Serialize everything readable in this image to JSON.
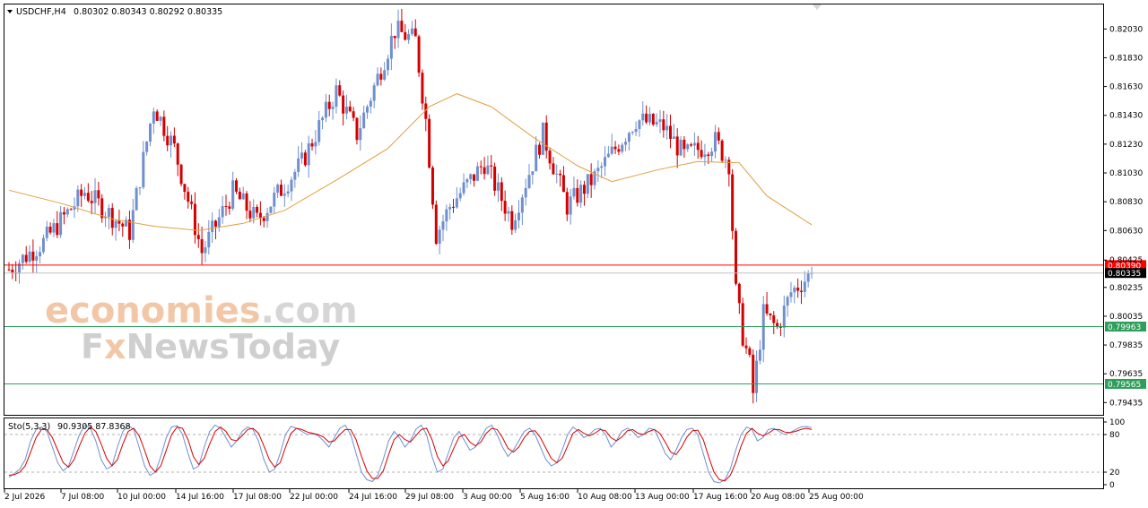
{
  "header": {
    "symbol": "USDCHF,H4",
    "ohlc": "0.80302 0.80343 0.80292 0.80335"
  },
  "watermark": {
    "line1_part1": "economies",
    "line1_part2": ".com",
    "line2_part1": "F",
    "line2_part2": "x",
    "line2_part3": "NewsToday"
  },
  "colors": {
    "bull": "#6f8fce",
    "bear": "#d40000",
    "ma": "#e0a040",
    "resistance": "#ff0000",
    "current": "#000000",
    "support": "#2e9e5b",
    "stoch_main": "#6f8fce",
    "stoch_signal": "#d40000",
    "watermark_orange": "#f2c7a7",
    "watermark_gray": "#cfcfcf"
  },
  "chart_data": [
    {
      "type": "candlestick",
      "ylim": [
        0.7935,
        0.822
      ],
      "y_ticks": [
        "0.82030",
        "0.81830",
        "0.81630",
        "0.81430",
        "0.81230",
        "0.81030",
        "0.80830",
        "0.80630",
        "0.80425",
        "0.80235",
        "0.80035",
        "0.79835",
        "0.79635",
        "0.79435"
      ],
      "x_ticks": [
        "2 Jul 2026",
        "7 Jul 08:00",
        "10 Jul 00:00",
        "14 Jul 16:00",
        "17 Jul 08:00",
        "22 Jul 00:00",
        "24 Jul 16:00",
        "29 Jul 08:00",
        "3 Aug 00:00",
        "5 Aug 16:00",
        "10 Aug 08:00",
        "13 Aug 00:00",
        "17 Aug 16:00",
        "20 Aug 08:00",
        "25 Aug 00:00"
      ],
      "moving_average": [
        [
          0,
          0.8091
        ],
        [
          15,
          0.8082
        ],
        [
          30,
          0.8071
        ],
        [
          42,
          0.8066
        ],
        [
          55,
          0.8063
        ],
        [
          68,
          0.8068
        ],
        [
          80,
          0.8077
        ],
        [
          95,
          0.8098
        ],
        [
          110,
          0.812
        ],
        [
          122,
          0.8149
        ],
        [
          130,
          0.8158
        ],
        [
          140,
          0.8149
        ],
        [
          152,
          0.8128
        ],
        [
          165,
          0.8108
        ],
        [
          175,
          0.8097
        ],
        [
          188,
          0.8105
        ],
        [
          200,
          0.8111
        ],
        [
          212,
          0.811
        ],
        [
          220,
          0.8087
        ],
        [
          233,
          0.8067
        ]
      ],
      "levels": [
        {
          "label": "0.80390",
          "value": 0.8039,
          "kind": "resistance"
        },
        {
          "label": "0.80335",
          "value": 0.80335,
          "kind": "current"
        },
        {
          "label": "0.79963",
          "value": 0.79963,
          "kind": "support"
        },
        {
          "label": "0.79565",
          "value": 0.79565,
          "kind": "support"
        }
      ],
      "anchors": [
        [
          0,
          0.8036
        ],
        [
          10,
          0.8055
        ],
        [
          22,
          0.809
        ],
        [
          35,
          0.8062
        ],
        [
          42,
          0.815
        ],
        [
          48,
          0.812
        ],
        [
          56,
          0.8048
        ],
        [
          65,
          0.809
        ],
        [
          72,
          0.807
        ],
        [
          85,
          0.811
        ],
        [
          95,
          0.816
        ],
        [
          101,
          0.813
        ],
        [
          112,
          0.8202
        ],
        [
          118,
          0.8195
        ],
        [
          121,
          0.814
        ],
        [
          124,
          0.806
        ],
        [
          128,
          0.808
        ],
        [
          138,
          0.811
        ],
        [
          146,
          0.807
        ],
        [
          155,
          0.813
        ],
        [
          162,
          0.808
        ],
        [
          170,
          0.81
        ],
        [
          182,
          0.814
        ],
        [
          190,
          0.8135
        ],
        [
          196,
          0.8115
        ],
        [
          205,
          0.8125
        ],
        [
          209,
          0.811
        ],
        [
          211,
          0.802
        ],
        [
          213,
          0.799
        ],
        [
          215,
          0.797
        ],
        [
          216,
          0.795
        ],
        [
          219,
          0.8005
        ],
        [
          223,
          0.7995
        ],
        [
          227,
          0.802
        ],
        [
          233,
          0.80335
        ]
      ],
      "x_count": 234
    },
    {
      "type": "line",
      "indicator": "Sto(5,3,3)",
      "values_label": "90.9305 87.8368",
      "ylim": [
        0,
        100
      ],
      "y_ticks": [
        "100",
        "80",
        "20",
        "0"
      ],
      "levels": [
        80,
        20
      ],
      "series": [
        {
          "name": "main",
          "values": [
            12,
            18,
            25,
            40,
            70,
            88,
            92,
            85,
            60,
            35,
            22,
            30,
            55,
            80,
            95,
            90,
            70,
            40,
            25,
            30,
            60,
            85,
            95,
            88,
            60,
            30,
            15,
            20,
            45,
            75,
            92,
            94,
            80,
            50,
            25,
            30,
            60,
            85,
            95,
            90,
            75,
            60,
            70,
            85,
            92,
            88,
            70,
            40,
            20,
            25,
            50,
            80,
            93,
            90,
            85,
            80,
            82,
            78,
            70,
            60,
            75,
            90,
            95,
            80,
            50,
            20,
            8,
            5,
            15,
            40,
            70,
            85,
            75,
            60,
            70,
            88,
            95,
            80,
            45,
            20,
            25,
            50,
            75,
            85,
            70,
            55,
            60,
            75,
            90,
            95,
            80,
            60,
            45,
            55,
            70,
            85,
            90,
            80,
            60,
            40,
            30,
            35,
            55,
            80,
            92,
            85,
            75,
            80,
            88,
            90,
            80,
            60,
            70,
            85,
            90,
            85,
            75,
            80,
            90,
            88,
            70,
            50,
            40,
            55,
            75,
            88,
            90,
            80,
            50,
            20,
            5,
            3,
            8,
            25,
            55,
            80,
            92,
            88,
            70,
            75,
            88,
            90,
            85,
            80,
            83,
            88,
            92,
            93,
            91
          ]
        },
        {
          "name": "signal",
          "values": [
            15,
            16,
            20,
            30,
            52,
            75,
            88,
            88,
            75,
            55,
            35,
            28,
            40,
            62,
            82,
            92,
            85,
            65,
            42,
            30,
            40,
            65,
            85,
            90,
            78,
            55,
            30,
            20,
            30,
            55,
            80,
            92,
            90,
            72,
            45,
            32,
            42,
            65,
            85,
            92,
            85,
            72,
            70,
            78,
            88,
            90,
            82,
            62,
            40,
            28,
            35,
            60,
            82,
            90,
            88,
            84,
            82,
            80,
            76,
            68,
            70,
            80,
            88,
            88,
            72,
            45,
            22,
            10,
            10,
            22,
            48,
            72,
            80,
            72,
            68,
            78,
            88,
            90,
            72,
            45,
            30,
            38,
            58,
            76,
            80,
            68,
            62,
            68,
            82,
            90,
            88,
            75,
            58,
            52,
            60,
            75,
            85,
            86,
            75,
            58,
            42,
            35,
            42,
            62,
            82,
            88,
            82,
            78,
            82,
            88,
            86,
            75,
            70,
            76,
            86,
            88,
            82,
            80,
            85,
            88,
            82,
            68,
            52,
            48,
            60,
            76,
            86,
            87,
            72,
            45,
            20,
            8,
            6,
            15,
            35,
            62,
            82,
            90,
            82,
            78,
            82,
            88,
            88,
            84,
            83,
            85,
            88,
            90,
            88
          ]
        }
      ]
    }
  ]
}
